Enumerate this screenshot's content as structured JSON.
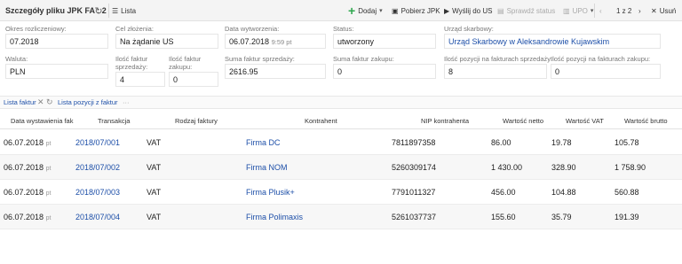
{
  "toolbar": {
    "title": "Szczegóły pliku JPK FA : 2",
    "list_label": "Lista",
    "add_label": "Dodaj",
    "download_label": "Pobierz JPK",
    "send_label": "Wyślij do US",
    "check_label": "Sprawdź status",
    "upo_label": "UPO",
    "pager": "1 z 2",
    "delete_label": "Usuń"
  },
  "form": {
    "period": {
      "label": "Okres rozliczeniowy:",
      "value": "07.2018"
    },
    "purpose": {
      "label": "Cel złożenia:",
      "value": "Na żądanie US"
    },
    "created": {
      "label": "Data wytworzenia:",
      "value": "06.07.2018",
      "time": "9:59 pt"
    },
    "status": {
      "label": "Status:",
      "value": "utworzony"
    },
    "office": {
      "label": "Urząd skarbowy:",
      "value": "Urząd Skarbowy w Aleksandrowie Kujawskim"
    },
    "currency": {
      "label": "Waluta:",
      "value": "PLN"
    },
    "sales_count": {
      "label_1": "Ilość faktur",
      "label_2": "sprzedaży:",
      "value": "4"
    },
    "purchase_count": {
      "label_1": "Ilość faktur",
      "label_2": "zakupu:",
      "value": "0"
    },
    "sales_sum": {
      "label": "Suma faktur sprzedaży:",
      "value": "2616.95"
    },
    "purchase_sum": {
      "label": "Suma faktur zakupu:",
      "value": "0"
    },
    "sales_positions": {
      "label": "Ilość pozycji na fakturach sprzedaży:",
      "value": "8"
    },
    "purchase_positions": {
      "label": "Ilość pozycji na fakturach zakupu:",
      "value": "0"
    }
  },
  "tabs": {
    "invoices": "Lista faktur",
    "positions": "Lista pozycji z faktur",
    "more": "···"
  },
  "table": {
    "headers": [
      "Data wystawienia fak",
      "Transakcja",
      "Rodzaj faktury",
      "Kontrahent",
      "NIP kontrahenta",
      "Wartość netto",
      "Wartość VAT",
      "Wartość brutto"
    ],
    "rows": [
      {
        "date": "06.07.2018",
        "suffix": "pt",
        "transaction": "2018/07/001",
        "type": "VAT",
        "contractor": "Firma DC",
        "nip": "7811897358",
        "net": "86.00",
        "vat": "19.78",
        "gross": "105.78"
      },
      {
        "date": "06.07.2018",
        "suffix": "pt",
        "transaction": "2018/07/002",
        "type": "VAT",
        "contractor": "Firma NOM",
        "nip": "5260309174",
        "net": "1 430.00",
        "vat": "328.90",
        "gross": "1 758.90"
      },
      {
        "date": "06.07.2018",
        "suffix": "pt",
        "transaction": "2018/07/003",
        "type": "VAT",
        "contractor": "Firma Plusik+",
        "nip": "7791011327",
        "net": "456.00",
        "vat": "104.88",
        "gross": "560.88"
      },
      {
        "date": "06.07.2018",
        "suffix": "pt",
        "transaction": "2018/07/004",
        "type": "VAT",
        "contractor": "Firma Polimaxis",
        "nip": "5261037737",
        "net": "155.60",
        "vat": "35.79",
        "gross": "191.39"
      }
    ]
  },
  "colors": {
    "link": "#1d4fa8",
    "add": "#2fa84f"
  }
}
